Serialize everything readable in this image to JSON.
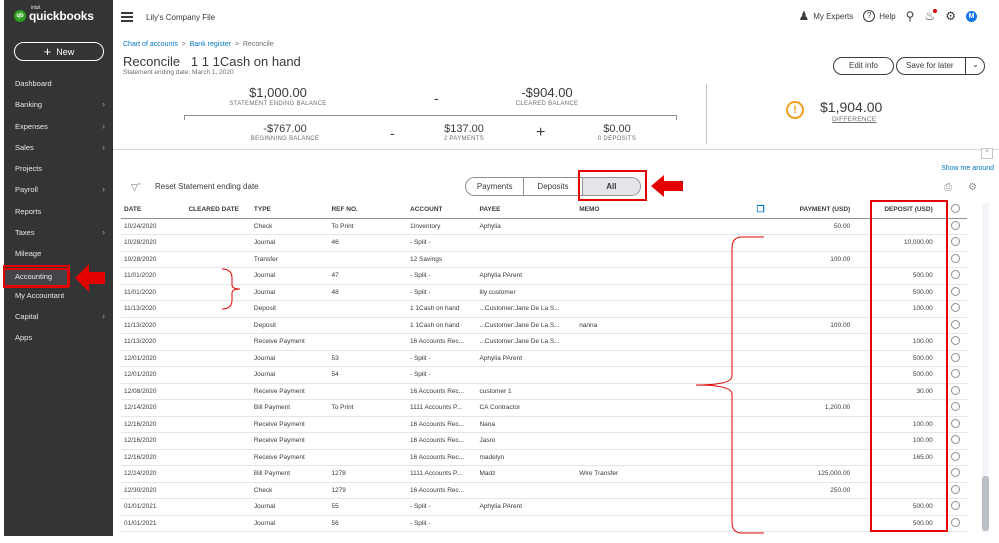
{
  "app": {
    "logo_text": "quickbooks",
    "logo_sup": "intuit",
    "logo_mark": "qb"
  },
  "sidebar": {
    "new_label": "New",
    "items": [
      {
        "label": "Dashboard",
        "chevron": false
      },
      {
        "label": "Banking",
        "chevron": true
      },
      {
        "label": "Expenses",
        "chevron": true
      },
      {
        "label": "Sales",
        "chevron": true
      },
      {
        "label": "Projects",
        "chevron": false
      },
      {
        "label": "Payroll",
        "chevron": true
      },
      {
        "label": "Reports",
        "chevron": false
      },
      {
        "label": "Taxes",
        "chevron": true
      },
      {
        "label": "Mileage",
        "chevron": false
      },
      {
        "label": "Accounting",
        "chevron": false,
        "active": true
      },
      {
        "label": "My Accountant",
        "chevron": false
      },
      {
        "label": "Capital",
        "chevron": true
      },
      {
        "label": "Apps",
        "chevron": false
      }
    ]
  },
  "topbar": {
    "company": "Lily's Company File",
    "experts": "My Experts",
    "help": "Help",
    "avatar": "M"
  },
  "breadcrumb": {
    "a": "Chart of accounts",
    "b": "Bank register",
    "c": "Reconcile"
  },
  "header": {
    "title": "Reconcile   1 1 1Cash on hand",
    "statement_date": "Statement ending date: March 1, 2020",
    "edit_info": "Edit info",
    "save_for_later": "Save for later"
  },
  "summary": {
    "statement_ending_balance": "$1,000.00",
    "statement_ending_balance_label": "STATEMENT ENDING BALANCE",
    "cleared_balance": "-$904.00",
    "cleared_balance_label": "CLEARED BALANCE",
    "beginning_balance": "-$767.00",
    "beginning_balance_label": "BEGINNING BALANCE",
    "payments": "$137.00",
    "payments_label": "2 PAYMENTS",
    "deposits": "$0.00",
    "deposits_label": "0 DEPOSITS",
    "difference": "$1,904.00",
    "difference_label": "DIFFERENCE",
    "op_minus": "-",
    "op_plus": "+"
  },
  "toolbar": {
    "show_me_around": "Show me around",
    "reset": "Reset Statement ending date",
    "tabs": [
      "Payments",
      "Deposits",
      "All"
    ],
    "active_tab": "All"
  },
  "table": {
    "columns": [
      "DATE",
      "CLEARED DATE",
      "TYPE",
      "REF NO.",
      "ACCOUNT",
      "PAYEE",
      "MEMO",
      "",
      "PAYMENT (USD)",
      "DEPOSIT (USD)",
      ""
    ],
    "rows": [
      [
        "10/24/2020",
        "",
        "Check",
        "To Print",
        "1Inventory",
        "Aphylia",
        "",
        "50.00",
        ""
      ],
      [
        "10/28/2020",
        "",
        "Journal",
        "46",
        "- Split -",
        "",
        "",
        "",
        "10,000.00"
      ],
      [
        "10/28/2020",
        "",
        "Transfer",
        "",
        "12 Savings",
        "",
        "",
        "100.00",
        ""
      ],
      [
        "11/01/2020",
        "",
        "Journal",
        "47",
        "- Split -",
        "Aphylia PArent",
        "",
        "",
        "500.00"
      ],
      [
        "11/01/2020",
        "",
        "Journal",
        "48",
        "- Split -",
        "lily customer",
        "",
        "",
        "500.00"
      ],
      [
        "11/13/2020",
        "",
        "Deposit",
        "",
        "1 1Cash on hand",
        "...Customer:Jane De La S...",
        "",
        "",
        "100.00"
      ],
      [
        "11/13/2020",
        "",
        "Deposit",
        "",
        "1 1Cash on hand",
        "...Customer:Jane De La S...",
        "nanna",
        "100.00",
        ""
      ],
      [
        "11/13/2020",
        "",
        "Receive Payment",
        "",
        "16 Accounts Rec...",
        "...Customer:Jane De La S...",
        "",
        "",
        "100.00"
      ],
      [
        "12/01/2020",
        "",
        "Journal",
        "53",
        "- Split -",
        "Aphylia PArent",
        "",
        "",
        "500.00"
      ],
      [
        "12/01/2020",
        "",
        "Journal",
        "54",
        "- Split -",
        "",
        "",
        "",
        "500.00"
      ],
      [
        "12/08/2020",
        "",
        "Receive Payment",
        "",
        "16 Accounts Rec...",
        "customer 1",
        "",
        "",
        "30.00"
      ],
      [
        "12/14/2020",
        "",
        "Bill Payment",
        "To Print",
        "1111 Accounts P...",
        "CA Contractor",
        "",
        "1,200.00",
        ""
      ],
      [
        "12/16/2020",
        "",
        "Receive Payment",
        "",
        "16 Accounts Rec...",
        "Nana",
        "",
        "",
        "100.00"
      ],
      [
        "12/16/2020",
        "",
        "Receive Payment",
        "",
        "16 Accounts Rec...",
        "Jasro",
        "",
        "",
        "100.00"
      ],
      [
        "12/16/2020",
        "",
        "Receive Payment",
        "",
        "16 Accounts Rec...",
        "madelyn",
        "",
        "",
        "165.00"
      ],
      [
        "12/24/2020",
        "",
        "Bill Payment",
        "1278",
        "1111 Accounts P...",
        "Madz",
        "Wire Transfer",
        "125,000.00",
        ""
      ],
      [
        "12/30/2020",
        "",
        "Check",
        "1279",
        "16 Accounts Rec...",
        "",
        "",
        "250.00",
        ""
      ],
      [
        "01/01/2021",
        "",
        "Journal",
        "55",
        "- Split -",
        "Aphylia PArent",
        "",
        "",
        "500.00"
      ],
      [
        "01/01/2021",
        "",
        "Journal",
        "56",
        "- Split -",
        "",
        "",
        "",
        "500.00"
      ]
    ]
  },
  "colors": {
    "sidebar_bg": "#333436",
    "accent_green": "#2ca01c",
    "annotation_red": "#e30000",
    "warning": "#f2a01c",
    "link": "#0077c5"
  }
}
